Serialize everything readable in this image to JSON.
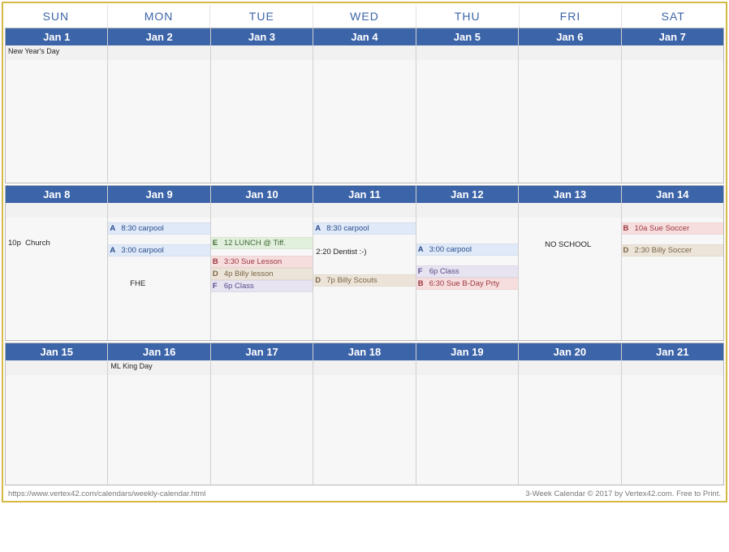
{
  "dayhead": [
    "SUN",
    "MON",
    "TUE",
    "WED",
    "THU",
    "FRI",
    "SAT"
  ],
  "weeks": [
    {
      "days": [
        {
          "date": "Jan 1",
          "top": "New Year's Day",
          "items": []
        },
        {
          "date": "Jan 2",
          "top": "",
          "items": []
        },
        {
          "date": "Jan 3",
          "top": "",
          "items": []
        },
        {
          "date": "Jan 4",
          "top": "",
          "items": []
        },
        {
          "date": "Jan 5",
          "top": "",
          "items": []
        },
        {
          "date": "Jan 6",
          "top": "",
          "items": []
        },
        {
          "date": "Jan 7",
          "top": "",
          "items": []
        }
      ]
    },
    {
      "days": [
        {
          "date": "Jan 8",
          "top": "",
          "items": [
            {
              "kind": "gap"
            },
            {
              "kind": "gap"
            },
            {
              "kind": "gap"
            },
            {
              "kind": "gap"
            },
            {
              "kind": "plain",
              "text": "10p  Church"
            }
          ]
        },
        {
          "date": "Jan 9",
          "top": "",
          "items": [
            {
              "kind": "gap"
            },
            {
              "kind": "ev",
              "code": "A",
              "text": "8:30 carpool"
            },
            {
              "kind": "gap"
            },
            {
              "kind": "gap"
            },
            {
              "kind": "ev",
              "code": "A",
              "text": "3:00 carpool"
            },
            {
              "kind": "gap"
            },
            {
              "kind": "gap"
            },
            {
              "kind": "gap"
            },
            {
              "kind": "gap"
            },
            {
              "kind": "gap-sm"
            },
            {
              "kind": "plain",
              "text": "         FHE"
            }
          ]
        },
        {
          "date": "Jan 10",
          "top": "",
          "items": [
            {
              "kind": "gap"
            },
            {
              "kind": "gap"
            },
            {
              "kind": "gap"
            },
            {
              "kind": "gap"
            },
            {
              "kind": "ev",
              "code": "E",
              "text": "12 LUNCH @ Tiff."
            },
            {
              "kind": "gap"
            },
            {
              "kind": "gap-sm"
            },
            {
              "kind": "ev",
              "code": "B",
              "text": "3:30 Sue Lesson"
            },
            {
              "kind": "ev",
              "code": "D",
              "text": "4p Billy lesson"
            },
            {
              "kind": "ev",
              "code": "F",
              "text": "6p Class"
            }
          ]
        },
        {
          "date": "Jan 11",
          "top": "",
          "items": [
            {
              "kind": "gap"
            },
            {
              "kind": "ev",
              "code": "A",
              "text": "8:30 carpool"
            },
            {
              "kind": "gap"
            },
            {
              "kind": "gap"
            },
            {
              "kind": "gap-sm"
            },
            {
              "kind": "plain",
              "text": "2:20 Dentist :-)"
            },
            {
              "kind": "gap"
            },
            {
              "kind": "gap"
            },
            {
              "kind": "gap"
            },
            {
              "kind": "gap-sm"
            },
            {
              "kind": "ev",
              "code": "D",
              "text": "7p Billy Scouts"
            }
          ]
        },
        {
          "date": "Jan 12",
          "top": "",
          "items": [
            {
              "kind": "gap"
            },
            {
              "kind": "gap"
            },
            {
              "kind": "gap"
            },
            {
              "kind": "gap"
            },
            {
              "kind": "gap"
            },
            {
              "kind": "gap-sm"
            },
            {
              "kind": "ev",
              "code": "A",
              "text": "3:00 carpool"
            },
            {
              "kind": "gap"
            },
            {
              "kind": "gap"
            },
            {
              "kind": "ev",
              "code": "F",
              "text": "6p Class"
            },
            {
              "kind": "ev",
              "code": "B",
              "text": "6:30 Sue B-Day Prty"
            }
          ]
        },
        {
          "date": "Jan 13",
          "top": "",
          "items": [
            {
              "kind": "gap"
            },
            {
              "kind": "gap"
            },
            {
              "kind": "gap"
            },
            {
              "kind": "gap"
            },
            {
              "kind": "gap-sm"
            },
            {
              "kind": "plain",
              "text": "           NO SCHOOL"
            }
          ]
        },
        {
          "date": "Jan 14",
          "top": "",
          "items": [
            {
              "kind": "gap"
            },
            {
              "kind": "ev",
              "code": "B",
              "text": "10a Sue Soccer"
            },
            {
              "kind": "gap"
            },
            {
              "kind": "gap"
            },
            {
              "kind": "ev",
              "code": "D",
              "text": "2:30 Billy Soccer"
            }
          ]
        }
      ]
    },
    {
      "short": true,
      "days": [
        {
          "date": "Jan 15",
          "top": "",
          "items": []
        },
        {
          "date": "Jan 16",
          "top": "ML King Day",
          "items": []
        },
        {
          "date": "Jan 17",
          "top": "",
          "items": []
        },
        {
          "date": "Jan 18",
          "top": "",
          "items": []
        },
        {
          "date": "Jan 19",
          "top": "",
          "items": []
        },
        {
          "date": "Jan 20",
          "top": "",
          "items": []
        },
        {
          "date": "Jan 21",
          "top": "",
          "items": []
        }
      ]
    }
  ],
  "footer": {
    "left": "https://www.vertex42.com/calendars/weekly-calendar.html",
    "right": "3-Week Calendar © 2017 by Vertex42.com. Free to Print."
  }
}
